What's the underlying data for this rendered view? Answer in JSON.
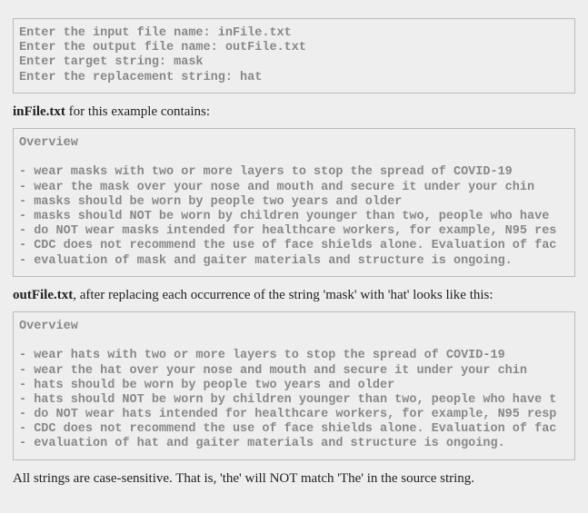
{
  "console": {
    "lines": [
      "Enter the input file name: inFile.txt",
      "Enter the output file name: outFile.txt",
      "Enter target string: mask",
      "Enter the replacement string: hat"
    ]
  },
  "para1_prefix": "inFile.txt",
  "para1_rest": " for this example contains:",
  "infile": {
    "lines": [
      "Overview",
      "",
      "- wear masks with two or more layers to stop the spread of COVID-19",
      "- wear the mask over your nose and mouth and secure it under your chin",
      "- masks should be worn by people two years and older",
      "- masks should NOT be worn by children younger than two, people who have ",
      "- do NOT wear masks intended for healthcare workers, for example, N95 res",
      "- CDC does not recommend the use of face shields alone. Evaluation of fac",
      "- evaluation of mask and gaiter materials and structure is ongoing."
    ]
  },
  "para2_prefix": "outFile.txt",
  "para2_rest": ", after replacing each occurrence of the string 'mask' with 'hat' looks like this:",
  "outfile": {
    "lines": [
      "Overview",
      "",
      "- wear hats with two or more layers to stop the spread of COVID-19",
      "- wear the hat over your nose and mouth and secure it under your chin",
      "- hats should be worn by people two years and older",
      "- hats should NOT be worn by children younger than two, people who have t",
      "- do NOT wear hats intended for healthcare workers, for example, N95 resp",
      "- CDC does not recommend the use of face shields alone. Evaluation of fac",
      "- evaluation of hat and gaiter materials and structure is ongoing."
    ]
  },
  "para3": "All strings are case-sensitive. That is, 'the' will NOT match 'The' in the source string."
}
